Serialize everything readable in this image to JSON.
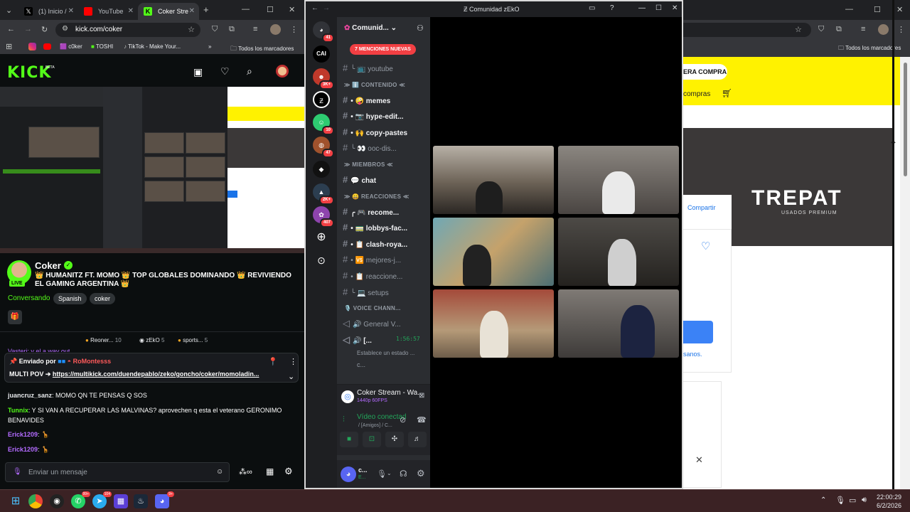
{
  "left_browser": {
    "tabs": [
      {
        "label": "(1) Inicio /",
        "color": "#000000",
        "icon": "x-logo-icon"
      },
      {
        "label": "YouTube",
        "color": "#ff0000",
        "icon": "youtube-icon"
      },
      {
        "label": "Coker Stre",
        "color": "#53fc18",
        "icon": "kick-icon"
      }
    ],
    "url": "kick.com/coker",
    "bookmarks": [
      "c0ker",
      "TOSHI",
      "TikTok - Make Your...",
      "Todos los marcadores"
    ]
  },
  "kick": {
    "logo": "KICK",
    "beta": "BETA",
    "streamer": "Coker",
    "live_label": "LIVE",
    "title": "👑 HUMANITZ FT. MOMO 👑 TOP GLOBALES DOMINANDO 👑 REVIVIENDO EL GAMING ARGENTINA 👑",
    "category": "Conversando",
    "tags": [
      "Spanish",
      "coker"
    ],
    "chat_tabs": [
      {
        "label": "Reoner...",
        "count": "10"
      },
      {
        "label": "zEkO",
        "count": "5"
      },
      {
        "label": "sports...",
        "count": "5"
      }
    ],
    "cutoff_line": "Vasteri: y el a way out",
    "pinned": {
      "by_label": "Enviado por",
      "user": "RoMontesss",
      "message_prefix": "MULTI POV ➔",
      "link": "https://multikick.com/duendepablo/zeko/goncho/coker/momoladin..."
    },
    "messages": [
      {
        "user": "juancruz_sanz",
        "text": "MOMO QN TE PENSAS Q SOS",
        "color": "#e8eaed"
      },
      {
        "user": "Tunnix",
        "text": "Y SI VAN A RECUPERAR LAS MALVINAS? aprovechen q esta el veterano GERONIMO BENAVIDES",
        "color": "#53fc18"
      },
      {
        "user": "Erick1209",
        "text": "🦒",
        "color": "#b36bff"
      },
      {
        "user": "Erick1209",
        "text": "🦒",
        "color": "#b36bff"
      }
    ],
    "input_placeholder": "Enviar un mensaje",
    "infinity": "∞"
  },
  "discord": {
    "window_title": "Comunidad zEkO",
    "server_name": "Comunid...",
    "mentions": "7 MENCIONES NUEVAS",
    "guild_badges": [
      "41",
      "3K+",
      "10",
      "47",
      "2K+",
      "407"
    ],
    "guild_cai": "CAI",
    "channels": [
      {
        "type": "channel",
        "name": "╰ 📺 youtube"
      },
      {
        "type": "category",
        "name": "≫ ℹ️ CONTENIDO ≪"
      },
      {
        "type": "channel",
        "name": "• 🤪 memes",
        "active": true
      },
      {
        "type": "channel",
        "name": "• 📷 hype-edit...",
        "active": true
      },
      {
        "type": "channel",
        "name": "• 🙌 copy-pastes",
        "active": true
      },
      {
        "type": "channel",
        "name": "╰ 👀 ooc-dis..."
      },
      {
        "type": "category",
        "name": "≫ MIEMBROS ≪"
      },
      {
        "type": "channel",
        "name": "💬 chat",
        "active": true
      },
      {
        "type": "category",
        "name": "≫ 😄 REACCIONES ≪"
      },
      {
        "type": "channel",
        "name": "╭ 🎮 recome...",
        "active": true
      },
      {
        "type": "channel",
        "name": "• 🚃 lobbys-fac...",
        "active": true
      },
      {
        "type": "channel",
        "name": "• 📋 clash-roya...",
        "active": true
      },
      {
        "type": "channel",
        "name": "• 🆚 mejores-j..."
      },
      {
        "type": "channel",
        "name": "• 📋 reaccione..."
      },
      {
        "type": "channel",
        "name": "╰ 💻 setups"
      },
      {
        "type": "category",
        "name": "🎙️ VOICE CHANN..."
      },
      {
        "type": "voice",
        "name": "🔊 General V..."
      },
      {
        "type": "voice",
        "name": "🔊 [...",
        "active": true
      }
    ],
    "voice_timer": "1:56:57",
    "voice_status": "Establece un estado ...",
    "voice_user": "c...",
    "activity": {
      "title": "Coker Stream - Wa...",
      "sub": "1440p 60FPS"
    },
    "connection": {
      "title": "Vídeo conectad",
      "sub": "/ [Amigos] / C..."
    },
    "user": {
      "name": "c...",
      "status": "E..."
    }
  },
  "right_browser": {
    "bookmarks_all": "Todos los marcadores",
    "buy_button": "ERA COMPRA",
    "compras": "compras",
    "brand": "TREPAT",
    "brand_sub": "USADOS PREMIUM",
    "share": "Compartir",
    "link_text": "sanos."
  },
  "taskbar": {
    "badges": {
      "whatsapp": "99+",
      "telegram": "104",
      "discord": "9+"
    },
    "time": "22:00:29",
    "date": "6/2/2026"
  },
  "colors": {
    "kick_green": "#53fc18",
    "discord_red": "#f23f43",
    "yellow": "#fff200",
    "link_blue": "#1a73e8"
  }
}
